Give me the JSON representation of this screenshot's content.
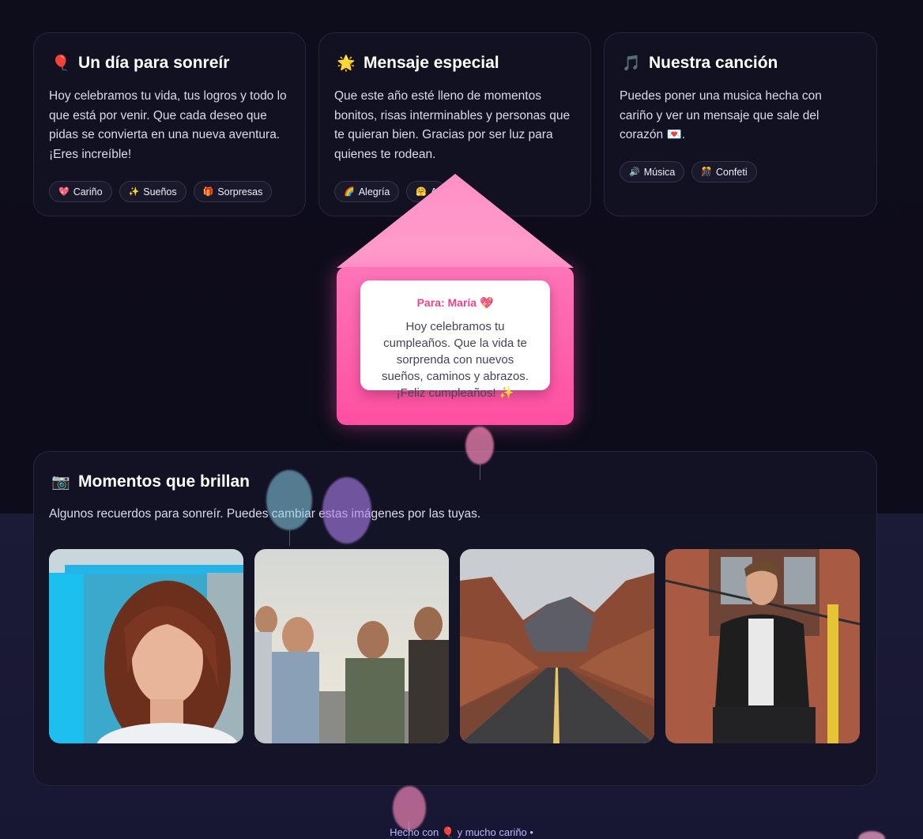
{
  "cards": [
    {
      "icon": "balloon-icon",
      "emoji": "🎈",
      "title": "Un día para sonreír",
      "text": "Hoy celebramos tu vida, tus logros y todo lo que está por venir. Que cada deseo que pidas se convierta en una nueva aventura. ¡Eres increíble!",
      "tags": [
        {
          "emoji": "💖",
          "label": "Cariño"
        },
        {
          "emoji": "✨",
          "label": "Sueños"
        },
        {
          "emoji": "🎁",
          "label": "Sorpresas"
        }
      ]
    },
    {
      "icon": "sun-icon",
      "emoji": "🌟",
      "title": "Mensaje especial",
      "text": "Que este año esté lleno de momentos bonitos, risas interminables y personas que te quieran bien. Gracias por ser luz para quienes te rodean.",
      "tags": [
        {
          "emoji": "🌈",
          "label": "Alegría"
        },
        {
          "emoji": "🤗",
          "label": "A"
        }
      ]
    },
    {
      "icon": "music-note-icon",
      "emoji": "🎵",
      "title": "Nuestra canción",
      "text": "Puedes poner una musica hecha con cariño y ver un mensaje que sale del corazón 💌.",
      "tags": [
        {
          "emoji": "🔊",
          "label": "Música"
        },
        {
          "emoji": "🎊",
          "label": "Confeti"
        }
      ]
    }
  ],
  "envelope": {
    "to": "Para: María 💖",
    "message": "Hoy celebramos tu cumpleaños. Que la vida te sorprenda con nuevos sueños, caminos y abrazos. ¡Feliz cumpleaños! ✨",
    "colors": {
      "flap": "#ff8ec4",
      "body": "#ff5aa8"
    }
  },
  "gallery": {
    "icon": "camera-icon",
    "emoji": "📷",
    "title": "Momentos que brillan",
    "subtitle": "Algunos recuerdos para sonreír. Puedes cambiar estas imágenes por las tuyas.",
    "photos": [
      {
        "name": "photo-woman-portrait"
      },
      {
        "name": "photo-friends-celebrating"
      },
      {
        "name": "photo-desert-road"
      },
      {
        "name": "photo-man-leather-jacket"
      }
    ]
  },
  "footer": {
    "text": "Hecho con 🎈 y mucho cariño •"
  }
}
